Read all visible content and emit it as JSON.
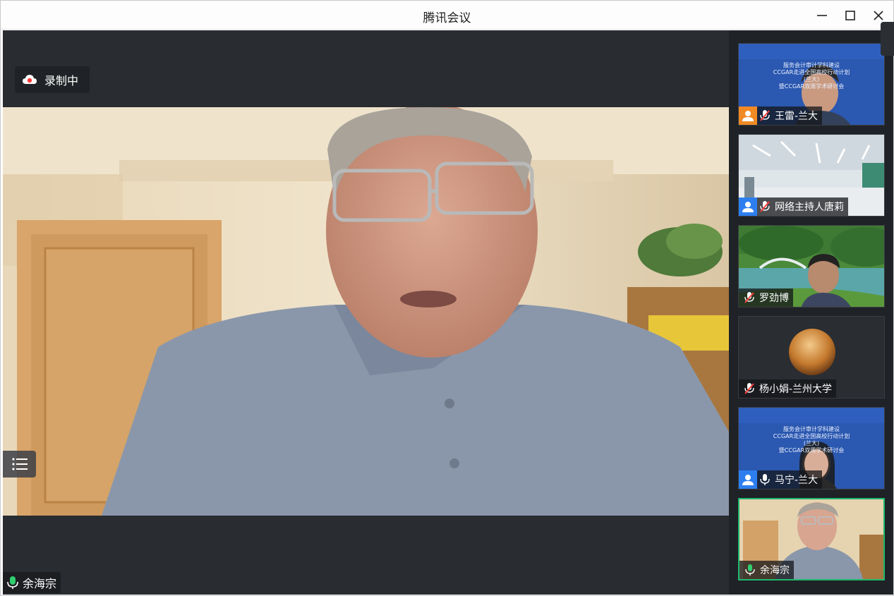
{
  "window": {
    "title": "腾讯会议"
  },
  "recording": {
    "label": "录制中"
  },
  "main": {
    "speaker_name": "余海宗"
  },
  "colors": {
    "accent_green": "#1fb96e",
    "record_red": "#ff3b3b",
    "avatar_orange": "#f08a24",
    "avatar_blue": "#2d7ff0"
  },
  "participants": [
    {
      "name": "王雷-兰大",
      "mic": "muted",
      "avatar": "orange",
      "background": "slide"
    },
    {
      "name": "网络主持人唐莉",
      "mic": "muted",
      "avatar": "blue",
      "background": "classroom"
    },
    {
      "name": "罗劲博",
      "mic": "muted",
      "avatar": "",
      "background": "garden"
    },
    {
      "name": "杨小娟-兰州大学",
      "mic": "muted",
      "avatar": "",
      "background": "dark-circle"
    },
    {
      "name": "马宁-兰大",
      "mic": "on",
      "avatar": "blue",
      "background": "slide"
    },
    {
      "name": "余海宗",
      "mic": "on",
      "avatar": "",
      "background": "office",
      "active": true
    }
  ],
  "slide": {
    "line1": "服务会计审计学科建设",
    "line2": "CCGAR走进全国高校行动计划",
    "line3": "(兰大)",
    "line4": "暨CCGAR双周学术研讨会"
  },
  "icons": {
    "cloud": "cloud-record-icon",
    "list": "list-icon",
    "mic_on": "mic-on-icon",
    "mic_muted": "mic-muted-icon",
    "user": "user-avatar-icon"
  }
}
